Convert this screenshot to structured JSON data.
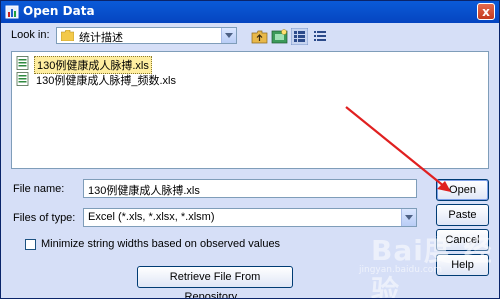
{
  "window": {
    "title": "Open Data",
    "close_label": "x"
  },
  "look_in": {
    "label": "Look in:",
    "value": "统计描述"
  },
  "files": [
    {
      "name": "130例健康成人脉搏.xls",
      "selected": true
    },
    {
      "name": "130例健康成人脉搏_频数.xls",
      "selected": false
    }
  ],
  "file_name": {
    "label": "File name:",
    "value": "130例健康成人脉搏.xls"
  },
  "file_type": {
    "label": "Files of type:",
    "value": "Excel (*.xls, *.xlsx, *.xlsm)"
  },
  "minimize_option": {
    "label": "Minimize string widths based on observed values",
    "checked": false
  },
  "buttons": {
    "open": "Open",
    "paste": "Paste",
    "cancel": "Cancel",
    "help": "Help",
    "retrieve": "Retrieve File From Repository..."
  },
  "watermark": {
    "brand": "Bai度 经验",
    "url": "jingyan.baidu.com"
  },
  "colors": {
    "title_bar": "#0545c0",
    "dialog_bg": "#d6dff7",
    "selection": "#ffeea0",
    "annotation_arrow": "#e02020"
  }
}
